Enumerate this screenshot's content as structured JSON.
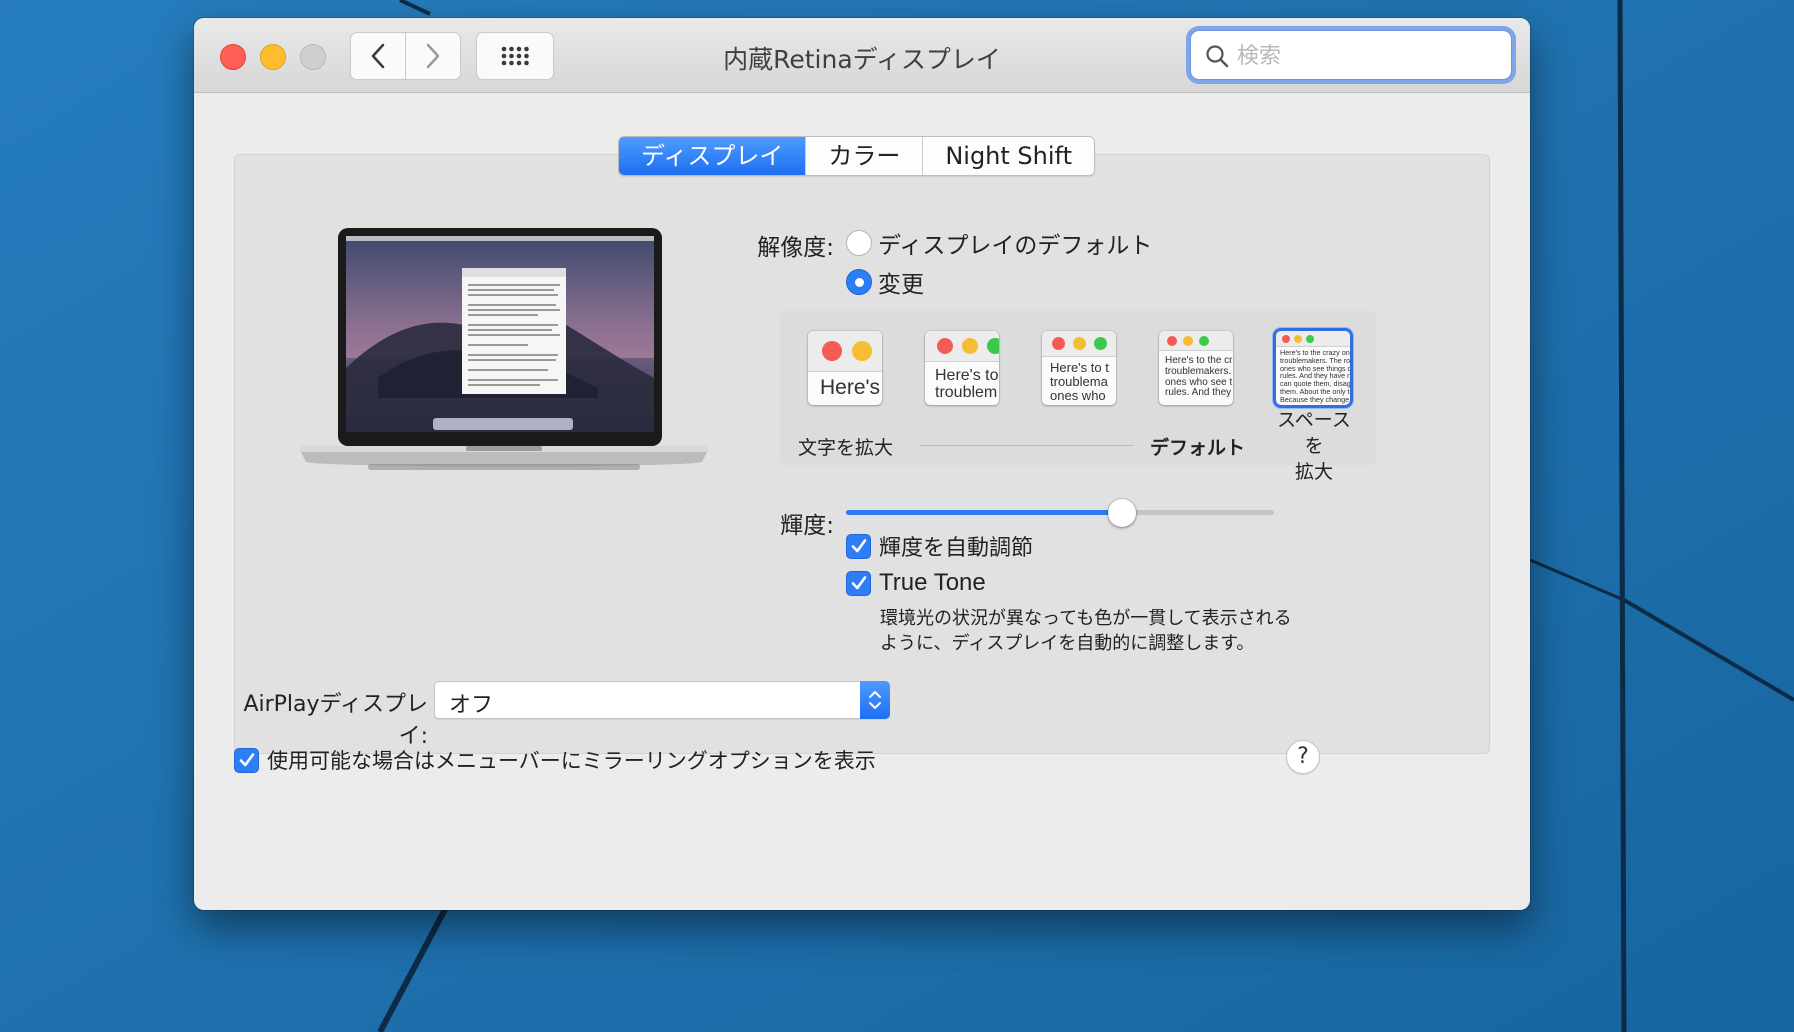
{
  "window": {
    "title": "内蔵Retinaディスプレイ"
  },
  "toolbar": {
    "back": "back",
    "forward": "forward",
    "show_all": "show-all"
  },
  "search": {
    "placeholder": "検索",
    "value": ""
  },
  "tabs": [
    {
      "label": "ディスプレイ",
      "active": true
    },
    {
      "label": "カラー",
      "active": false
    },
    {
      "label": "Night Shift",
      "active": false
    }
  ],
  "resolution": {
    "label": "解像度:",
    "options": [
      {
        "label": "ディスプレイのデフォルト",
        "selected": false
      },
      {
        "label": "変更",
        "selected": true
      }
    ],
    "scaled": {
      "thumb_texts": [
        "Here's",
        "Here's to\ntroublem",
        "Here's to t\ntroublema\nones who",
        "Here's to the cr\ntroublemakers.\nones who see t\nrules. And they",
        "Here's to the crazy ones\ntroublemakers. The rou\nones who see things di\nrules. And they have no\ncan quote them, disagr\nthem. About the only th\nBecause they change th"
      ],
      "selected_index": 4,
      "left_label": "文字を拡大",
      "default_label": "デフォルト",
      "right_label": "スペースを\n拡大"
    }
  },
  "brightness": {
    "label": "輝度:",
    "value": 0.646,
    "auto_label": "輝度を自動調節",
    "auto_checked": true,
    "truetone_label": "True Tone",
    "truetone_checked": true,
    "truetone_desc_line1": "環境光の状況が異なっても色が一貫して表示される",
    "truetone_desc_line2": "ように、ディスプレイを自動的に調整します。"
  },
  "airplay": {
    "label": "AirPlayディスプレイ:",
    "value": "オフ"
  },
  "mirroring": {
    "label": "使用可能な場合はメニューバーにミラーリングオプションを表示",
    "checked": true
  },
  "help": {
    "label": "?"
  },
  "colors": {
    "accent": "#2c7df6",
    "desktop": "#1f72b0"
  }
}
